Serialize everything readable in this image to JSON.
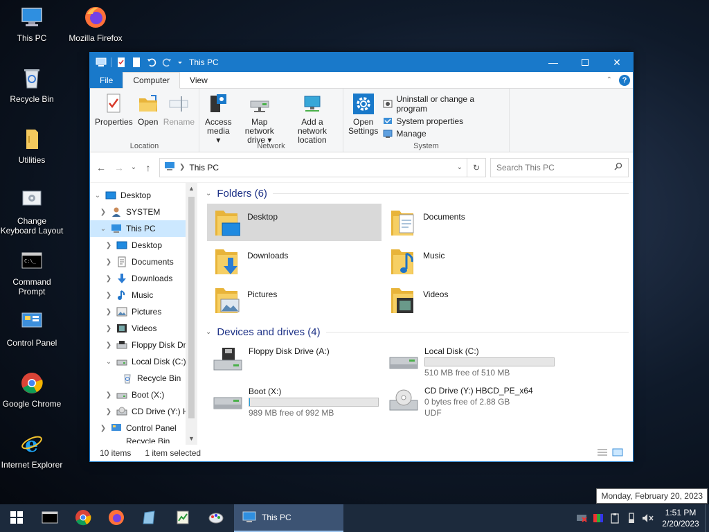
{
  "desktop": {
    "icons": [
      {
        "label": "This PC"
      },
      {
        "label": "Mozilla Firefox"
      },
      {
        "label": "Recycle Bin"
      },
      {
        "label": "Utilities"
      },
      {
        "label": "Change Keyboard Layout"
      },
      {
        "label": "Command Prompt"
      },
      {
        "label": "Control Panel"
      },
      {
        "label": "Google Chrome"
      },
      {
        "label": "Internet Explorer"
      }
    ]
  },
  "window": {
    "title": "This PC",
    "tabs": {
      "file": "File",
      "computer": "Computer",
      "view": "View"
    },
    "ribbon": {
      "location": {
        "label": "Location",
        "properties": "Properties",
        "open": "Open",
        "rename": "Rename"
      },
      "network": {
        "label": "Network",
        "access_media_1": "Access",
        "access_media_2": "media",
        "map_drive_1": "Map network",
        "map_drive_2": "drive",
        "add_location_1": "Add a network",
        "add_location_2": "location"
      },
      "system": {
        "label": "System",
        "open_settings_1": "Open",
        "open_settings_2": "Settings",
        "uninstall": "Uninstall or change a program",
        "system_properties": "System properties",
        "manage": "Manage"
      }
    },
    "address": {
      "crumb": "This PC"
    },
    "search": {
      "placeholder": "Search This PC"
    },
    "nav": [
      {
        "label": "Desktop"
      },
      {
        "label": "SYSTEM"
      },
      {
        "label": "This PC"
      },
      {
        "label": "Desktop"
      },
      {
        "label": "Documents"
      },
      {
        "label": "Downloads"
      },
      {
        "label": "Music"
      },
      {
        "label": "Pictures"
      },
      {
        "label": "Videos"
      },
      {
        "label": "Floppy Disk Dri"
      },
      {
        "label": "Local Disk (C:)"
      },
      {
        "label": "Recycle Bin"
      },
      {
        "label": "Boot (X:)"
      },
      {
        "label": "CD Drive (Y:) H"
      },
      {
        "label": "Control Panel"
      },
      {
        "label": "Recycle Bin"
      }
    ],
    "folders": {
      "heading": "Folders (6)",
      "items": [
        "Desktop",
        "Documents",
        "Downloads",
        "Music",
        "Pictures",
        "Videos"
      ]
    },
    "drives": {
      "heading": "Devices and drives (4)",
      "items": [
        {
          "name": "Floppy Disk Drive (A:)",
          "free": "",
          "extra": ""
        },
        {
          "name": "Local Disk (C:)",
          "free": "510 MB free of 510 MB",
          "extra": "",
          "used_fraction": 0.0
        },
        {
          "name": "Boot (X:)",
          "free": "989 MB free of 992 MB",
          "extra": "",
          "used_fraction": 0.003
        },
        {
          "name": "CD Drive (Y:) HBCD_PE_x64",
          "free": "0 bytes free of 2.88 GB",
          "extra": "UDF"
        }
      ]
    },
    "status": {
      "count": "10 items",
      "selected": "1 item selected"
    }
  },
  "taskbar": {
    "active_task": "This PC",
    "time": "1:51 PM",
    "date": "2/20/2023",
    "tooltip": "Monday, February 20, 2023"
  },
  "colors": {
    "accent": "#1979ca",
    "folder": "#f4c95d",
    "drive_bar": "#26a0da"
  }
}
